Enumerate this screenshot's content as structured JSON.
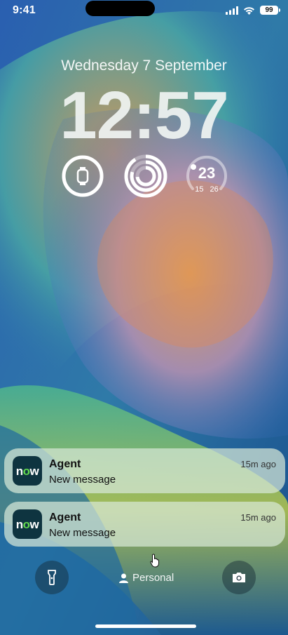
{
  "status_bar": {
    "time": "9:41",
    "battery": "99"
  },
  "lock_screen": {
    "date": "Wednesday 7 September",
    "time": "12:57",
    "widgets": {
      "weather_temp": "23",
      "weather_low": "15",
      "weather_high": "26"
    }
  },
  "notifications": [
    {
      "app": "Agent",
      "message": "New message",
      "time": "15m ago",
      "icon_text_a": "n",
      "icon_text_b": "o",
      "icon_text_c": "w"
    },
    {
      "app": "Agent",
      "message": "New message",
      "time": "15m ago",
      "icon_text_a": "n",
      "icon_text_b": "o",
      "icon_text_c": "w"
    }
  ],
  "bottom": {
    "focus_label": "Personal"
  }
}
